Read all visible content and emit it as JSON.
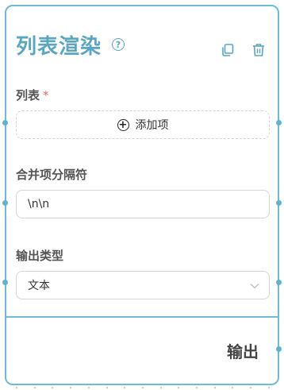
{
  "node": {
    "title": "列表渲染",
    "help_icon": "question-circle-icon",
    "actions": [
      {
        "name": "copy",
        "icon": "copy-icon"
      },
      {
        "name": "delete",
        "icon": "trash-icon"
      }
    ]
  },
  "list_field": {
    "label": "列表",
    "required_mark": "*",
    "add_button_label": "添加项"
  },
  "separator_field": {
    "label": "合并项分隔符",
    "value": "\\n\\n"
  },
  "output_type_field": {
    "label": "输出类型",
    "selected": "文本"
  },
  "output": {
    "label": "输出"
  },
  "colors": {
    "accent": "#5aa6c2",
    "border": "#6dbcd6",
    "required": "#e06c6c"
  }
}
